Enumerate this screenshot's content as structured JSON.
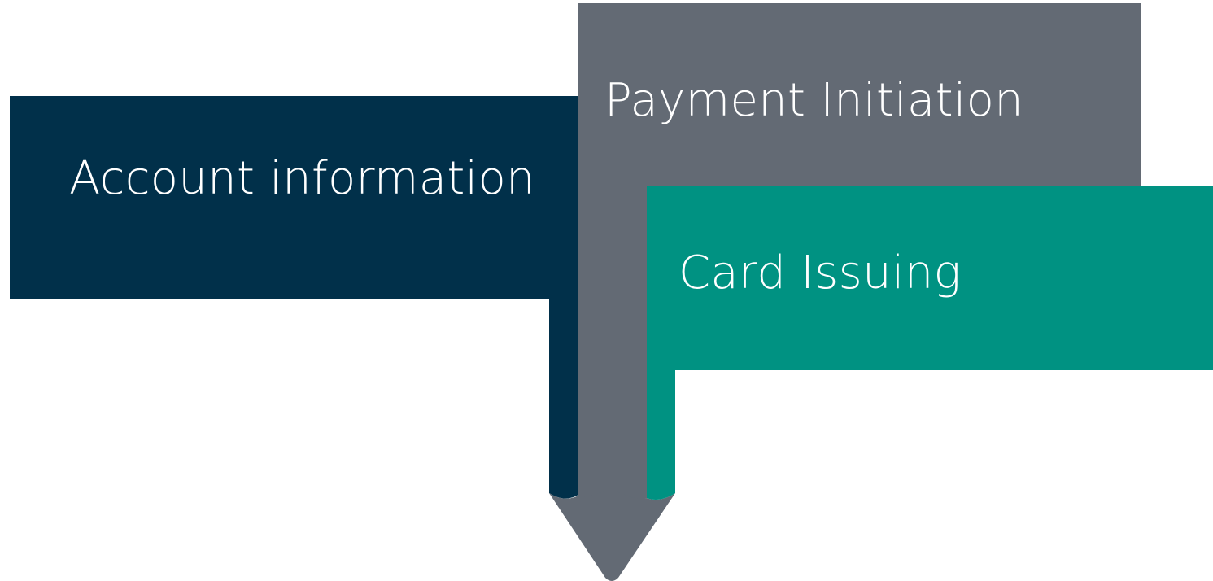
{
  "diagram": {
    "account": {
      "label": "Account information",
      "color": "#01304a"
    },
    "payment": {
      "label": "Payment Initiation",
      "color": "#636a74"
    },
    "card": {
      "label": "Card Issuing",
      "color": "#009282"
    },
    "background": "#ffffff"
  }
}
